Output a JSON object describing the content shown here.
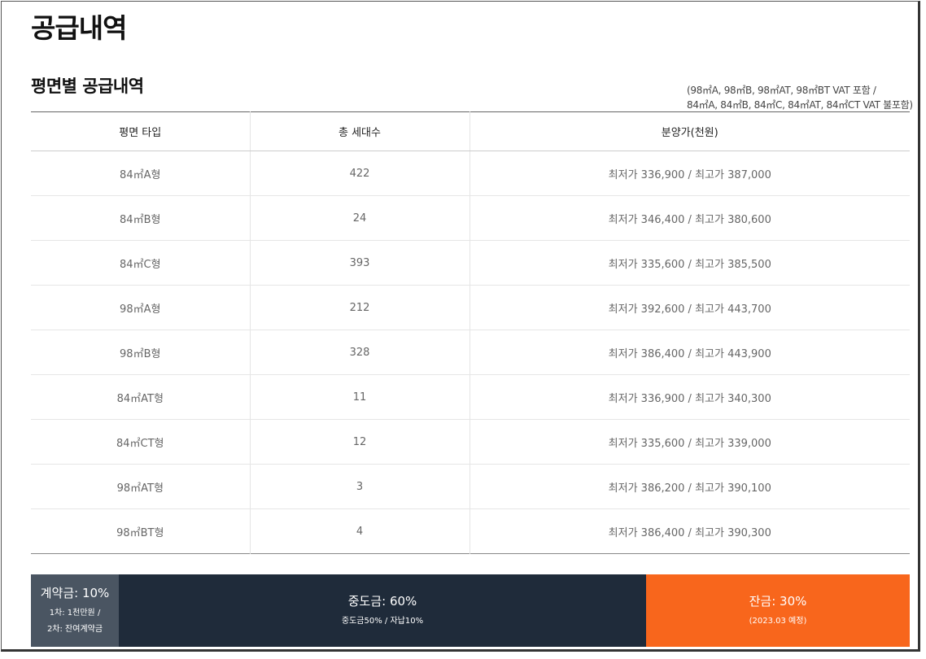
{
  "page": {
    "title": "공급내역"
  },
  "section": {
    "title": "평면별 공급내역"
  },
  "vat_note": {
    "line1": "(98㎡A, 98㎡B, 98㎡AT, 98㎡BT VAT 포함 /",
    "line2": "84㎡A, 84㎡B, 84㎡C, 84㎡AT, 84㎡CT VAT 불포함)"
  },
  "table": {
    "headers": [
      "평면 타입",
      "총 세대수",
      "분양가(천원)"
    ],
    "rows": [
      [
        "84㎡A형",
        "422",
        "최저가 336,900 / 최고가 387,000"
      ],
      [
        "84㎡B형",
        "24",
        "최저가 346,400 / 최고가 380,600"
      ],
      [
        "84㎡C형",
        "393",
        "최저가 335,600 / 최고가 385,500"
      ],
      [
        "98㎡A형",
        "212",
        "최저가 392,600 / 최고가 443,700"
      ],
      [
        "98㎡B형",
        "328",
        "최저가 386,400 / 최고가 443,900"
      ],
      [
        "84㎡AT형",
        "11",
        "최저가 336,900 / 최고가 340,300"
      ],
      [
        "84㎡CT형",
        "12",
        "최저가 335,600 / 최고가 339,000"
      ],
      [
        "98㎡AT형",
        "3",
        "최저가 386,200 / 최고가 390,100"
      ],
      [
        "98㎡BT형",
        "4",
        "최저가 386,400 / 최고가 390,300"
      ]
    ]
  },
  "payment": {
    "deposit": {
      "label": "계약금: 10%",
      "detail1": "1차: 1천만원 /",
      "detail2": "2차: 잔여계약금",
      "color": "#4a5562"
    },
    "middle": {
      "label": "중도금: 60%",
      "detail": "중도금50% / 자납10%",
      "color": "#1f2b3a"
    },
    "balance": {
      "label": "잔금: 30%",
      "detail": "(2023.03 예정)",
      "color": "#f8661c"
    }
  }
}
